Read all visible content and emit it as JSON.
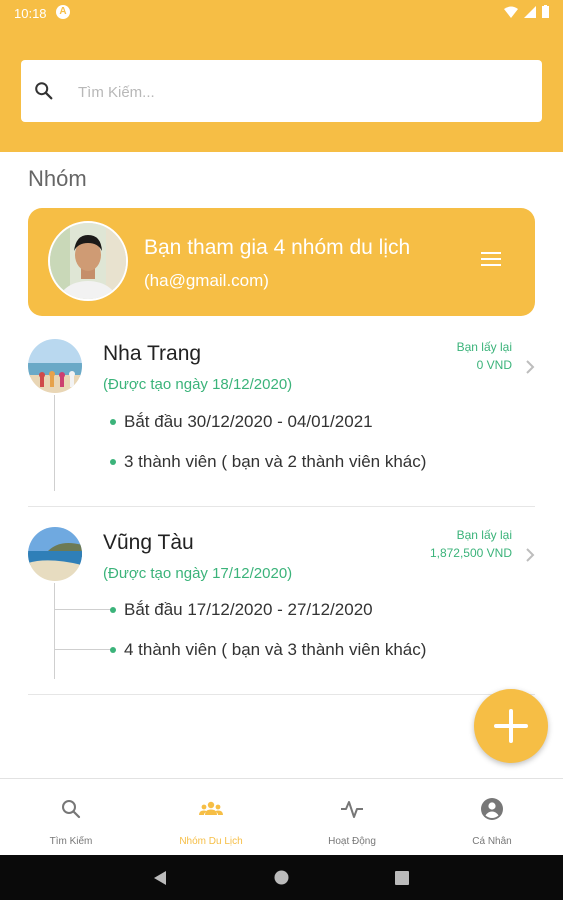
{
  "status": {
    "time": "10:18",
    "app_badge": "A"
  },
  "search": {
    "placeholder": "Tìm Kiếm..."
  },
  "section_title": "Nhóm",
  "profile": {
    "title": "Bạn tham gia 4 nhóm du lịch",
    "email": "(ha@gmail.com)"
  },
  "groups": [
    {
      "name": "Nha Trang",
      "created": "(Được tạo ngày 18/12/2020)",
      "dates": "Bắt đầu 30/12/2020 - 04/01/2021",
      "members": "3 thành viên ( bạn và 2 thành viên khác)",
      "refund_label": "Bạn lấy lại",
      "refund_amount": "0 VND"
    },
    {
      "name": "Vũng Tàu",
      "created": "(Được tạo ngày 17/12/2020)",
      "dates": "Bắt đầu 17/12/2020 - 27/12/2020",
      "members": "4 thành viên ( bạn và 3 thành viên khác)",
      "refund_label": "Bạn lấy lại",
      "refund_amount": "1,872,500 VND"
    }
  ],
  "bottom_nav": [
    {
      "label": "Tìm Kiếm",
      "icon": "search-icon",
      "active": false
    },
    {
      "label": "Nhóm Du Lịch",
      "icon": "group-icon",
      "active": true
    },
    {
      "label": "Hoạt Động",
      "icon": "activity-icon",
      "active": false
    },
    {
      "label": "Cá Nhân",
      "icon": "account-icon",
      "active": false
    }
  ],
  "colors": {
    "accent": "#F6BE45",
    "green": "#3BB37A"
  }
}
